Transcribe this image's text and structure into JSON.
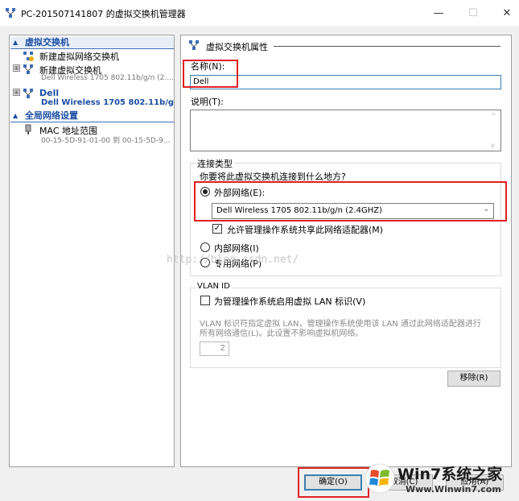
{
  "window": {
    "title": "PC-201507141807 的虚拟交换机管理器",
    "minimize_glyph": "—",
    "maximize_glyph": "☐",
    "close_glyph": "✕"
  },
  "tree": {
    "virtual_switches_header": "虚拟交换机",
    "new_switch_label": "新建虚拟网络交换机",
    "items": [
      {
        "label": "新建虚拟交换机",
        "sub": "Dell Wireless 1705 802.11b/g/n (2....",
        "expander": "⊞"
      },
      {
        "label": "Dell",
        "sub": "Dell Wireless 1705 802.11b/g/...",
        "expander": "⊞"
      }
    ],
    "global_header": "全局网络设置",
    "mac": {
      "label": "MAC 地址范围",
      "sub": "00-15-5D-91-01-00 到 00-15-5D-9..."
    }
  },
  "props": {
    "title": "虚拟交换机属性",
    "name_label": "名称(N):",
    "name_value": "Dell",
    "desc_label": "说明(T):",
    "desc_value": "",
    "conn_type_label": "连接类型",
    "conn_question": "你要将此虚拟交换机连接到什么地方?",
    "external_label": "外部网络(E):",
    "adapter_selected": "Dell Wireless 1705 802.11b/g/n (2.4GHZ)",
    "allow_share_label": "允许管理操作系统共享此网络适配器(M)",
    "internal_label": "内部网络(I)",
    "private_label": "专用网络(P)",
    "vlan_group_label": "VLAN ID",
    "vlan_enable_label": "为管理操作系统启用虚拟 LAN 标识(V)",
    "vlan_desc_line1": "VLAN 标识符指定虚拟 LAN，管理操作系统使用该 LAN 通过此网络适配器进行",
    "vlan_desc_line2": "所有网络通信(L)。此设置不影响虚拟机网络。",
    "vlan_value": "2",
    "remove_button": "移除(R)"
  },
  "buttons": {
    "ok": "确定(O)",
    "cancel": "取消(C)",
    "apply": "应用(A)"
  },
  "watermark": "http://blog.csdn.net/",
  "logo": {
    "main": "Win7系统之家",
    "url": "Www.Winwin7.com"
  },
  "colors": {
    "accent": "#3c7fb1",
    "highlight_box": "#e02020",
    "tree_header": "#1b4ea3"
  }
}
